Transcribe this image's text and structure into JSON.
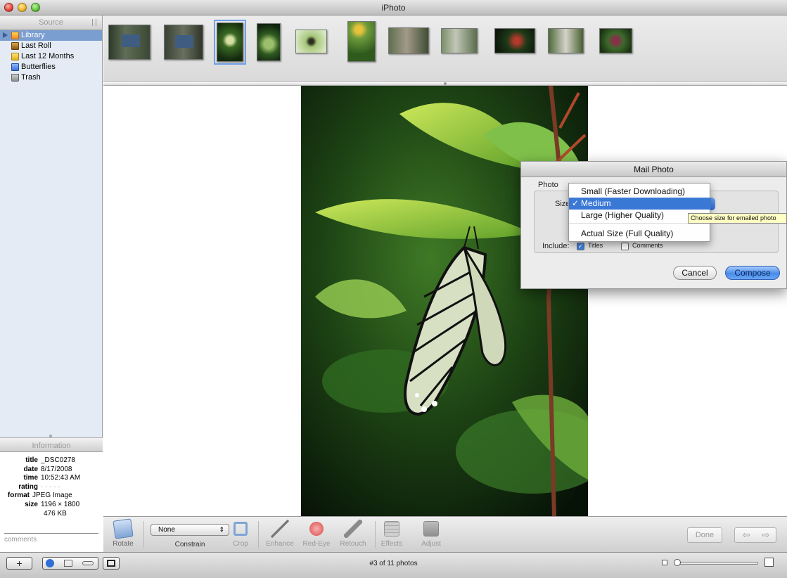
{
  "window": {
    "title": "iPhoto"
  },
  "sidebar": {
    "header": "Source",
    "items": [
      {
        "label": "Library",
        "icon": "library-icon"
      },
      {
        "label": "Last Roll",
        "icon": "film-roll-icon"
      },
      {
        "label": "Last 12 Months",
        "icon": "calendar-folder-icon"
      },
      {
        "label": "Butterflies",
        "icon": "album-icon"
      },
      {
        "label": "Trash",
        "icon": "trash-icon"
      }
    ]
  },
  "info": {
    "header": "Information",
    "title_key": "title",
    "title": "_DSC0278",
    "date_key": "date",
    "date": "8/17/2008",
    "time_key": "time",
    "time": "10:52:43 AM",
    "rating_key": "rating",
    "rating": "· · · · ·",
    "format_key": "format",
    "format": "JPEG Image",
    "size_key": "size",
    "size": "1196 × 1800",
    "filesize": "476 KB",
    "comments_placeholder": "comments"
  },
  "toolbar": {
    "rotate": "Rotate",
    "constrain_value": "None",
    "constrain_arrow": "⇕",
    "constrain": "Constrain",
    "crop": "Crop",
    "enhance": "Enhance",
    "red_eye": "Red-Eye",
    "retouch": "Retouch",
    "effects": "Effects",
    "adjust": "Adjust",
    "done": "Done",
    "prev_arrow": "⇦",
    "next_arrow": "⇨"
  },
  "bottombar": {
    "add": "+",
    "status": "#3 of 11 photos"
  },
  "dialog": {
    "title": "Mail Photo",
    "group_label": "Photo",
    "size_label": "Size",
    "include_label": "Include:",
    "titles_label": "Titles",
    "comments_label": "Comments",
    "cancel": "Cancel",
    "compose": "Compose"
  },
  "size_menu": {
    "options": [
      "Small (Faster Downloading)",
      "Medium",
      "Large (Higher Quality)",
      "Actual Size (Full Quality)"
    ],
    "selected": "Medium",
    "check": "✓",
    "tooltip": "Choose size for emailed photo"
  },
  "colors": {
    "selection": "#3a78d6",
    "sidebar_bg": "#e4ebf5",
    "compose_blue": "#4a8be8"
  }
}
